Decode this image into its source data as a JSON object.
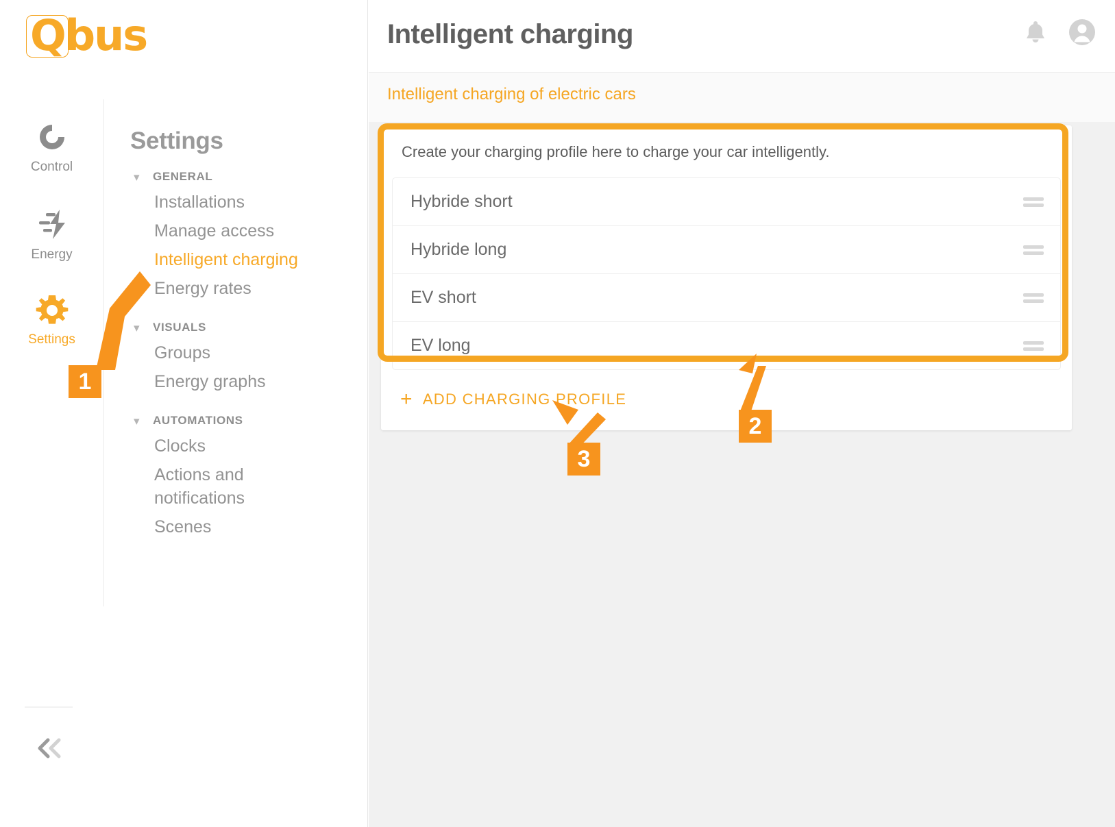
{
  "brand": {
    "name": "Qbus",
    "logo_icon": "qbus-logo",
    "accent_color": "#f5a623"
  },
  "rail": {
    "items": [
      {
        "label": "Control",
        "icon": "control-circle-icon",
        "active": false
      },
      {
        "label": "Energy",
        "icon": "energy-bolt-icon",
        "active": false
      },
      {
        "label": "Settings",
        "icon": "gear-icon",
        "active": true
      }
    ],
    "collapse_icon": "chevron-double-left-icon"
  },
  "settings_menu": {
    "title": "Settings",
    "groups": [
      {
        "label": "GENERAL",
        "chevron": "chevron-down-icon",
        "items": [
          {
            "label": "Installations",
            "active": false
          },
          {
            "label": "Manage access",
            "active": false
          },
          {
            "label": "Intelligent charging",
            "active": true
          },
          {
            "label": "Energy rates",
            "active": false
          }
        ]
      },
      {
        "label": "VISUALS",
        "chevron": "chevron-down-icon",
        "items": [
          {
            "label": "Groups",
            "active": false
          },
          {
            "label": "Energy graphs",
            "active": false
          }
        ]
      },
      {
        "label": "AUTOMATIONS",
        "chevron": "chevron-down-icon",
        "items": [
          {
            "label": "Clocks",
            "active": false
          },
          {
            "label": "Actions and notifications",
            "active": false
          },
          {
            "label": "Scenes",
            "active": false
          }
        ]
      }
    ]
  },
  "header": {
    "title": "Intelligent charging",
    "subtitle": "Intelligent charging of electric cars",
    "notification_icon": "bell-icon",
    "account_icon": "user-avatar-icon"
  },
  "content": {
    "intro": "Create your charging profile here to charge your car intelligently.",
    "profiles": [
      {
        "name": "Hybride short",
        "handle_icon": "drag-handle-icon"
      },
      {
        "name": "Hybride long",
        "handle_icon": "drag-handle-icon"
      },
      {
        "name": "EV short",
        "handle_icon": "drag-handle-icon"
      },
      {
        "name": "EV long",
        "handle_icon": "drag-handle-icon"
      }
    ],
    "add_button": {
      "label": "ADD CHARGING PROFILE",
      "plus_icon": "plus-icon",
      "plus": "+"
    }
  },
  "annotations": {
    "markers": [
      {
        "number": "1",
        "target": "Intelligent charging menu item"
      },
      {
        "number": "2",
        "target": "Charging profiles list"
      },
      {
        "number": "3",
        "target": "Add charging profile button"
      }
    ],
    "callout_color": "#f5a623"
  }
}
